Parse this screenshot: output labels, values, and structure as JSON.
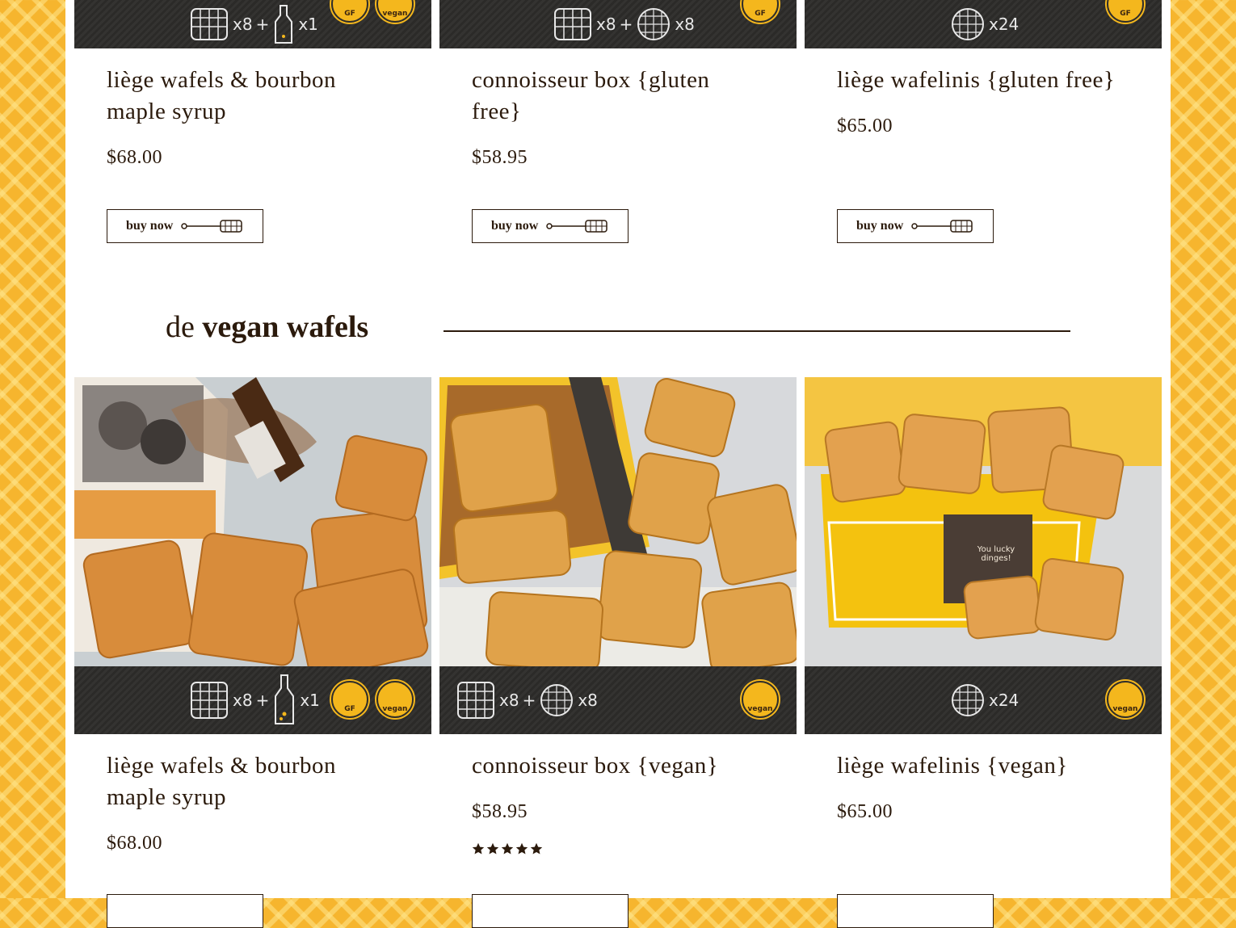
{
  "colors": {
    "background_yellow": "#f6b52e",
    "text_brown": "#2b1a0c",
    "badge_yellow": "#f4b71d",
    "band_dark": "#2e2d2b"
  },
  "section_gf": {
    "products": [
      {
        "title": "liège wafels & bourbon maple syrup",
        "price": "$68.00",
        "button": "buy now",
        "qty_labels": [
          "x8",
          "+",
          "x1"
        ],
        "badges": [
          "GF",
          "vegan"
        ]
      },
      {
        "title": "connoisseur box {gluten free}",
        "price": "$58.95",
        "button": "buy now",
        "qty_labels": [
          "x8",
          "+",
          "x8"
        ],
        "badges": [
          "GF"
        ]
      },
      {
        "title": "liège wafelinis {gluten free}",
        "price": "$65.00",
        "button": "buy now",
        "qty_labels": [
          "x24"
        ],
        "badges": [
          "GF"
        ]
      }
    ]
  },
  "section_vegan": {
    "heading_prefix": "de",
    "heading_bold": "vegan wafels",
    "products": [
      {
        "title": "liège wafels & bourbon maple syrup",
        "price": "$68.00",
        "qty_labels": [
          "x8",
          "+",
          "x1"
        ],
        "badges": [
          "GF",
          "vegan"
        ],
        "box_text": ""
      },
      {
        "title": "connoisseur box {vegan}",
        "price": "$58.95",
        "rating": 5,
        "qty_labels": [
          "x8",
          "+",
          "x8"
        ],
        "badges": [
          "vegan"
        ]
      },
      {
        "title": "liège wafelinis {vegan}",
        "price": "$65.00",
        "qty_labels": [
          "x24"
        ],
        "badges": [
          "vegan"
        ],
        "box_text": "You lucky dinges!"
      }
    ]
  }
}
